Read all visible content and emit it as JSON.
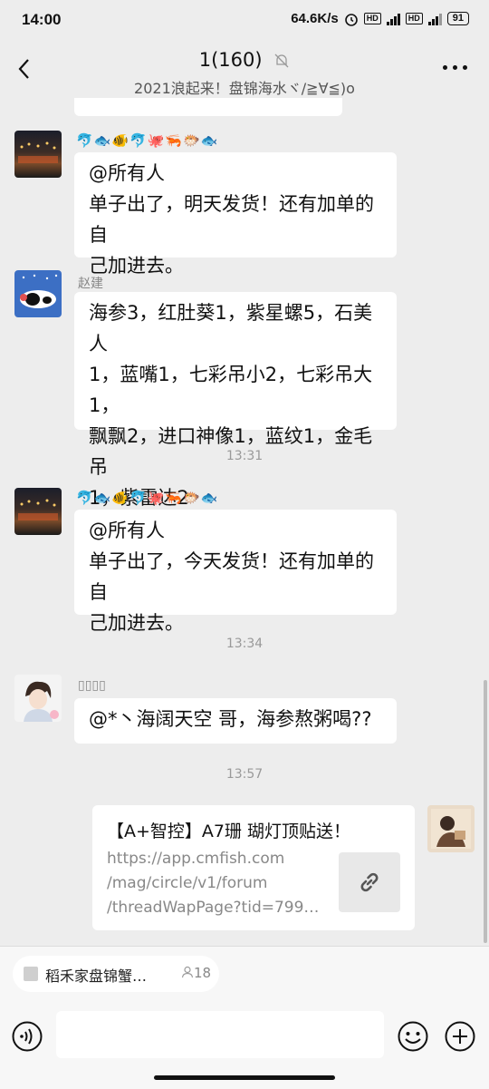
{
  "status_bar": {
    "time": "14:00",
    "speed": "64.6K/s",
    "battery": "91"
  },
  "header": {
    "title": "1(160)",
    "subtitle": "2021浪起来！盘锦海水ヾ/≧∀≦)o"
  },
  "messages": [
    {
      "type": "text",
      "emojis": "🐬🐟🐠🐬🐙🦐🐡🐟",
      "lines": [
        "@所有人",
        "单子出了，明天发货！还有加单的自",
        "己加进去。"
      ]
    },
    {
      "type": "text",
      "sender": "赵建",
      "lines": [
        "海参3，红肚葵1，紫星螺5，石美人",
        "1，蓝嘴1，七彩吊小2，七彩吊大1，",
        "飘飘2，进口神像1，蓝纹1，金毛吊",
        "1，紫雷达2"
      ]
    },
    {
      "type": "time",
      "text": "13:31"
    },
    {
      "type": "text",
      "emojis": "🐬🐟🐠🐬🐙🦐🐡🐟",
      "lines": [
        "@所有人",
        "单子出了，今天发货！还有加单的自",
        "己加进去。"
      ]
    },
    {
      "type": "time",
      "text": "13:34"
    },
    {
      "type": "text",
      "sender": "▯▯▯▯",
      "lines": [
        "@*丶海阔天空  哥，海参熬粥喝??"
      ]
    },
    {
      "type": "time",
      "text": "13:57"
    },
    {
      "type": "link",
      "title": "【A+智控】A7珊 瑚灯顶贴送！",
      "url_lines": [
        "https://app.cmfish.com",
        "/mag/circle/v1/forum",
        "/threadWapPage?tid=799…"
      ]
    }
  ],
  "quote_bar": {
    "label": "稻禾家盘锦蟹…",
    "count": "18"
  },
  "icons": [
    "back-icon",
    "mute-bell-icon",
    "more-icon",
    "voice-icon",
    "emoji-icon",
    "plus-icon",
    "link-icon"
  ]
}
